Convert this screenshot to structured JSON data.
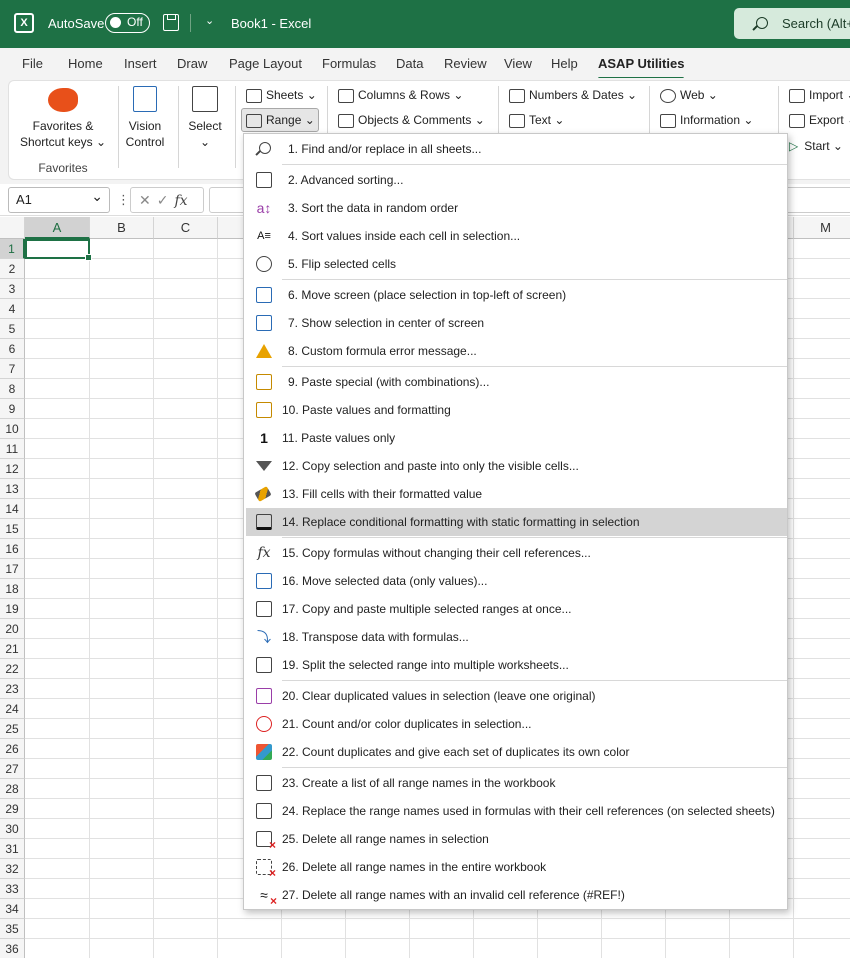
{
  "titlebar": {
    "autosave_label": "AutoSave",
    "toggle_label": "Off",
    "document": "Book1  -  Excel",
    "search": "Search (Alt+Q)"
  },
  "menubar": {
    "tabs": [
      "File",
      "Home",
      "Insert",
      "Draw",
      "Page Layout",
      "Formulas",
      "Data",
      "Review",
      "View",
      "Help",
      "ASAP Utilities"
    ]
  },
  "ribbon": {
    "favorites": {
      "line1": "Favorites &",
      "line2": "Shortcut keys",
      "group_label": "Favorites"
    },
    "vision": {
      "line1": "Vision",
      "line2": "Control"
    },
    "select": {
      "line1": "Select"
    },
    "sheets": "Sheets",
    "range": "Range",
    "columns_rows": "Columns & Rows",
    "objects_comments": "Objects & Comments",
    "numbers_dates": "Numbers & Dates",
    "text": "Text",
    "web": "Web",
    "information": "Information",
    "import": "Import",
    "export": "Export",
    "start": "Start"
  },
  "formula_bar": {
    "name_box": "A1",
    "fx": "fx"
  },
  "grid": {
    "columns": [
      "A",
      "B",
      "C",
      "D",
      "E",
      "F",
      "G",
      "H",
      "I",
      "J",
      "K",
      "L",
      "M"
    ],
    "rows": [
      "1",
      "2",
      "3",
      "4",
      "5",
      "6",
      "7",
      "8",
      "9",
      "10",
      "11",
      "12",
      "13",
      "14",
      "15",
      "16",
      "17",
      "18",
      "19",
      "20",
      "21",
      "22",
      "23",
      "24",
      "25",
      "26",
      "27",
      "28",
      "29",
      "30",
      "31",
      "32",
      "33",
      "34",
      "35",
      "36"
    ]
  },
  "dropdown": {
    "items": [
      "1. Find and/or replace in all sheets...",
      "2. Advanced sorting...",
      "3. Sort the data in random order",
      "4. Sort values inside each cell in selection...",
      "5. Flip selected cells",
      "6. Move screen (place selection in top-left of screen)",
      "7. Show selection in center of screen",
      "8. Custom formula error message...",
      "9. Paste special (with combinations)...",
      "10. Paste values and formatting",
      "11. Paste values only",
      "12. Copy selection and paste into only the visible cells...",
      "13. Fill cells with their formatted value",
      "14. Replace conditional formatting with static formatting in selection",
      "15. Copy formulas without changing their cell references...",
      "16. Move selected data (only values)...",
      "17. Copy and paste multiple selected ranges at once...",
      "18. Transpose data with formulas...",
      "19. Split the selected range into multiple worksheets...",
      "20. Clear duplicated values in selection (leave one original)",
      "21. Count and/or color duplicates in selection...",
      "22. Count duplicates and give each set of duplicates its own color",
      "23. Create a list of all range names in the workbook",
      "24. Replace the range names used in formulas with their cell references (on selected sheets)",
      "25. Delete all range names in selection",
      "26. Delete all range names in the entire workbook",
      "27. Delete all range names with an invalid cell reference (#REF!)"
    ]
  },
  "colors": {
    "excel_green": "#1e7145",
    "highlight": "#d4d4d4",
    "warning": "#e8a200"
  }
}
